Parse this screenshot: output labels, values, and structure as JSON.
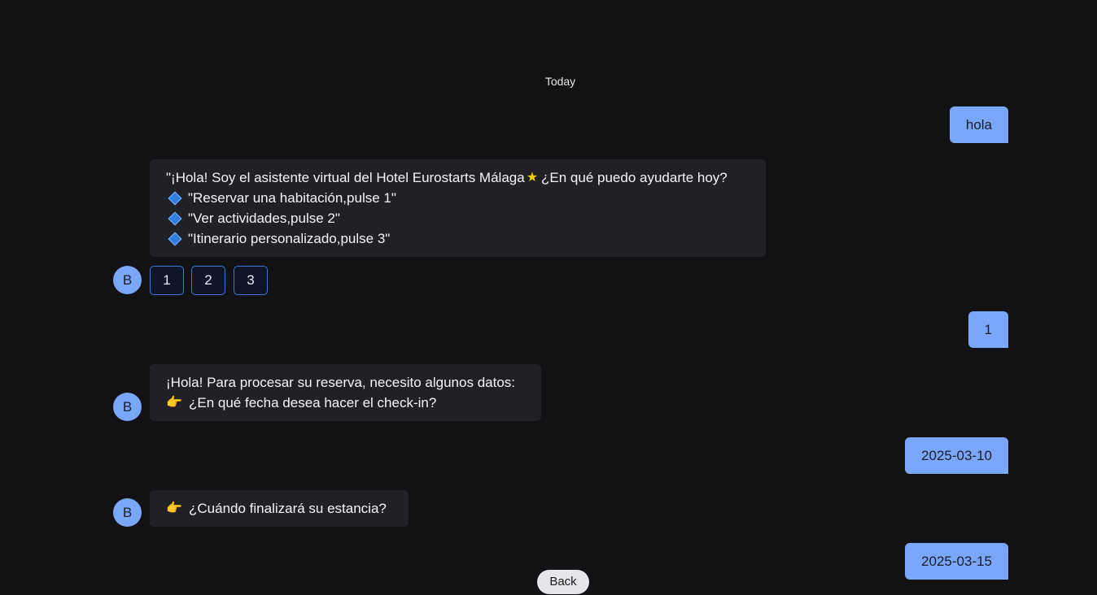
{
  "date_separator": "Today",
  "messages": {
    "user_hola": "hola",
    "bot_welcome": {
      "greeting_start": "\"¡Hola! Soy el asistente virtual del Hotel Eurostarts Málaga",
      "greeting_end": " ¿En qué puedo ayudarte hoy?",
      "options": [
        "\"Reservar una habitación,pulse 1\"",
        "\"Ver actividades,pulse 2\"",
        "\"Itinerario personalizado,pulse 3\""
      ]
    },
    "quick_replies": [
      "1",
      "2",
      "3"
    ],
    "user_choice": "1",
    "bot_reservation": {
      "line1": "¡Hola! Para procesar su reserva, necesito algunos datos:",
      "line2": "¿En qué fecha desea hacer el check-in?"
    },
    "user_checkin": "2025-03-10",
    "bot_checkout": "¿Cuándo finalizará su estancia?",
    "user_checkout": "2025-03-15"
  },
  "bot_avatar_letter": "B",
  "back_button": "Back",
  "icons": {
    "star": "star-icon",
    "diamond": "blue-diamond-icon",
    "pointer": "pointing-hand-icon"
  },
  "colors": {
    "background": "#121214",
    "user_bubble": "#7aa7f7",
    "bot_bubble": "#202127",
    "quick_reply_border": "#3b78d8"
  }
}
